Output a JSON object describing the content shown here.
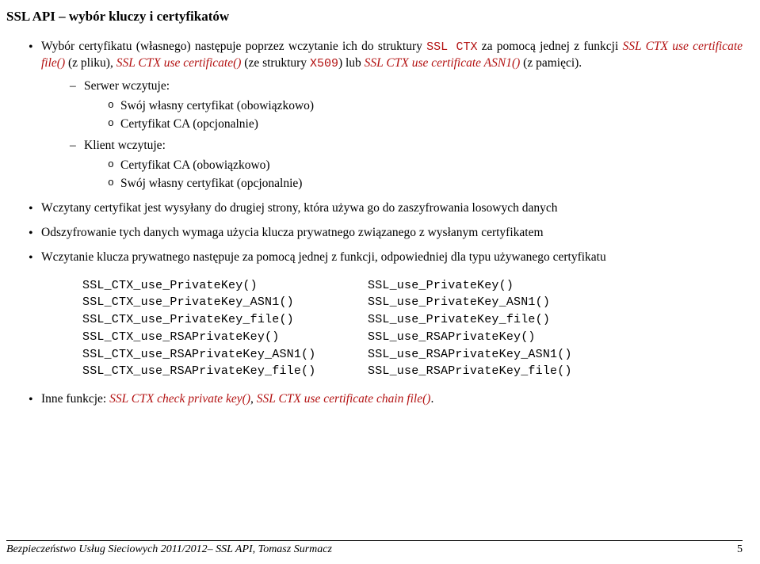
{
  "title": "SSL API – wybór kluczy i certyfikatów",
  "bullets": {
    "b1_pre": "Wybór certyfikatu (własnego) następuje poprzez wczytanie ich do struktury ",
    "b1_code1": "SSL CTX",
    "b1_mid1": " za pomocą jednej z funkcji ",
    "b1_fn1": "SSL CTX use certificate file()",
    "b1_mid2": " (z pliku), ",
    "b1_fn2": "SSL CTX use certificate()",
    "b1_mid3": " (ze struktury ",
    "b1_code2": "X509",
    "b1_mid4": ") lub ",
    "b1_fn3": "SSL CTX use certificate ASN1()",
    "b1_post": " (z pamięci).",
    "d1": "Serwer wczytuje:",
    "d1o1": "Swój własny certyfikat (obowiązkowo)",
    "d1o2": "Certyfikat CA (opcjonalnie)",
    "d2": "Klient wczytuje:",
    "d2o1": "Certyfikat CA (obowiązkowo)",
    "d2o2": "Swój własny certyfikat (opcjonalnie)",
    "b2": "Wczytany certyfikat jest wysyłany do drugiej strony, która używa go do zaszyfrowania losowych danych",
    "b3": "Odszyfrowanie tych danych wymaga użycia klucza prywatnego związanego z wysłanym certyfikatem",
    "b4": "Wczytanie klucza prywatnego następuje za pomocą jednej z funkcji, odpowiedniej dla typu używanego certyfikatu",
    "b5_pre": "Inne funkcje: ",
    "b5_fn1": "SSL CTX check private key()",
    "b5_mid": ", ",
    "b5_fn2": "SSL CTX use certificate chain file()",
    "b5_post": "."
  },
  "table": {
    "left": [
      "SSL_CTX_use_PrivateKey()",
      "SSL_CTX_use_PrivateKey_ASN1()",
      "SSL_CTX_use_PrivateKey_file()",
      "SSL_CTX_use_RSAPrivateKey()",
      "SSL_CTX_use_RSAPrivateKey_ASN1()",
      "SSL_CTX_use_RSAPrivateKey_file()"
    ],
    "right": [
      "SSL_use_PrivateKey()",
      "SSL_use_PrivateKey_ASN1()",
      "SSL_use_PrivateKey_file()",
      "SSL_use_RSAPrivateKey()",
      "SSL_use_RSAPrivateKey_ASN1()",
      "SSL_use_RSAPrivateKey_file()"
    ]
  },
  "footer": {
    "text": "Bezpieczeństwo Usług Sieciowych 2011/2012– SSL API, Tomasz Surmacz",
    "page": "5"
  }
}
